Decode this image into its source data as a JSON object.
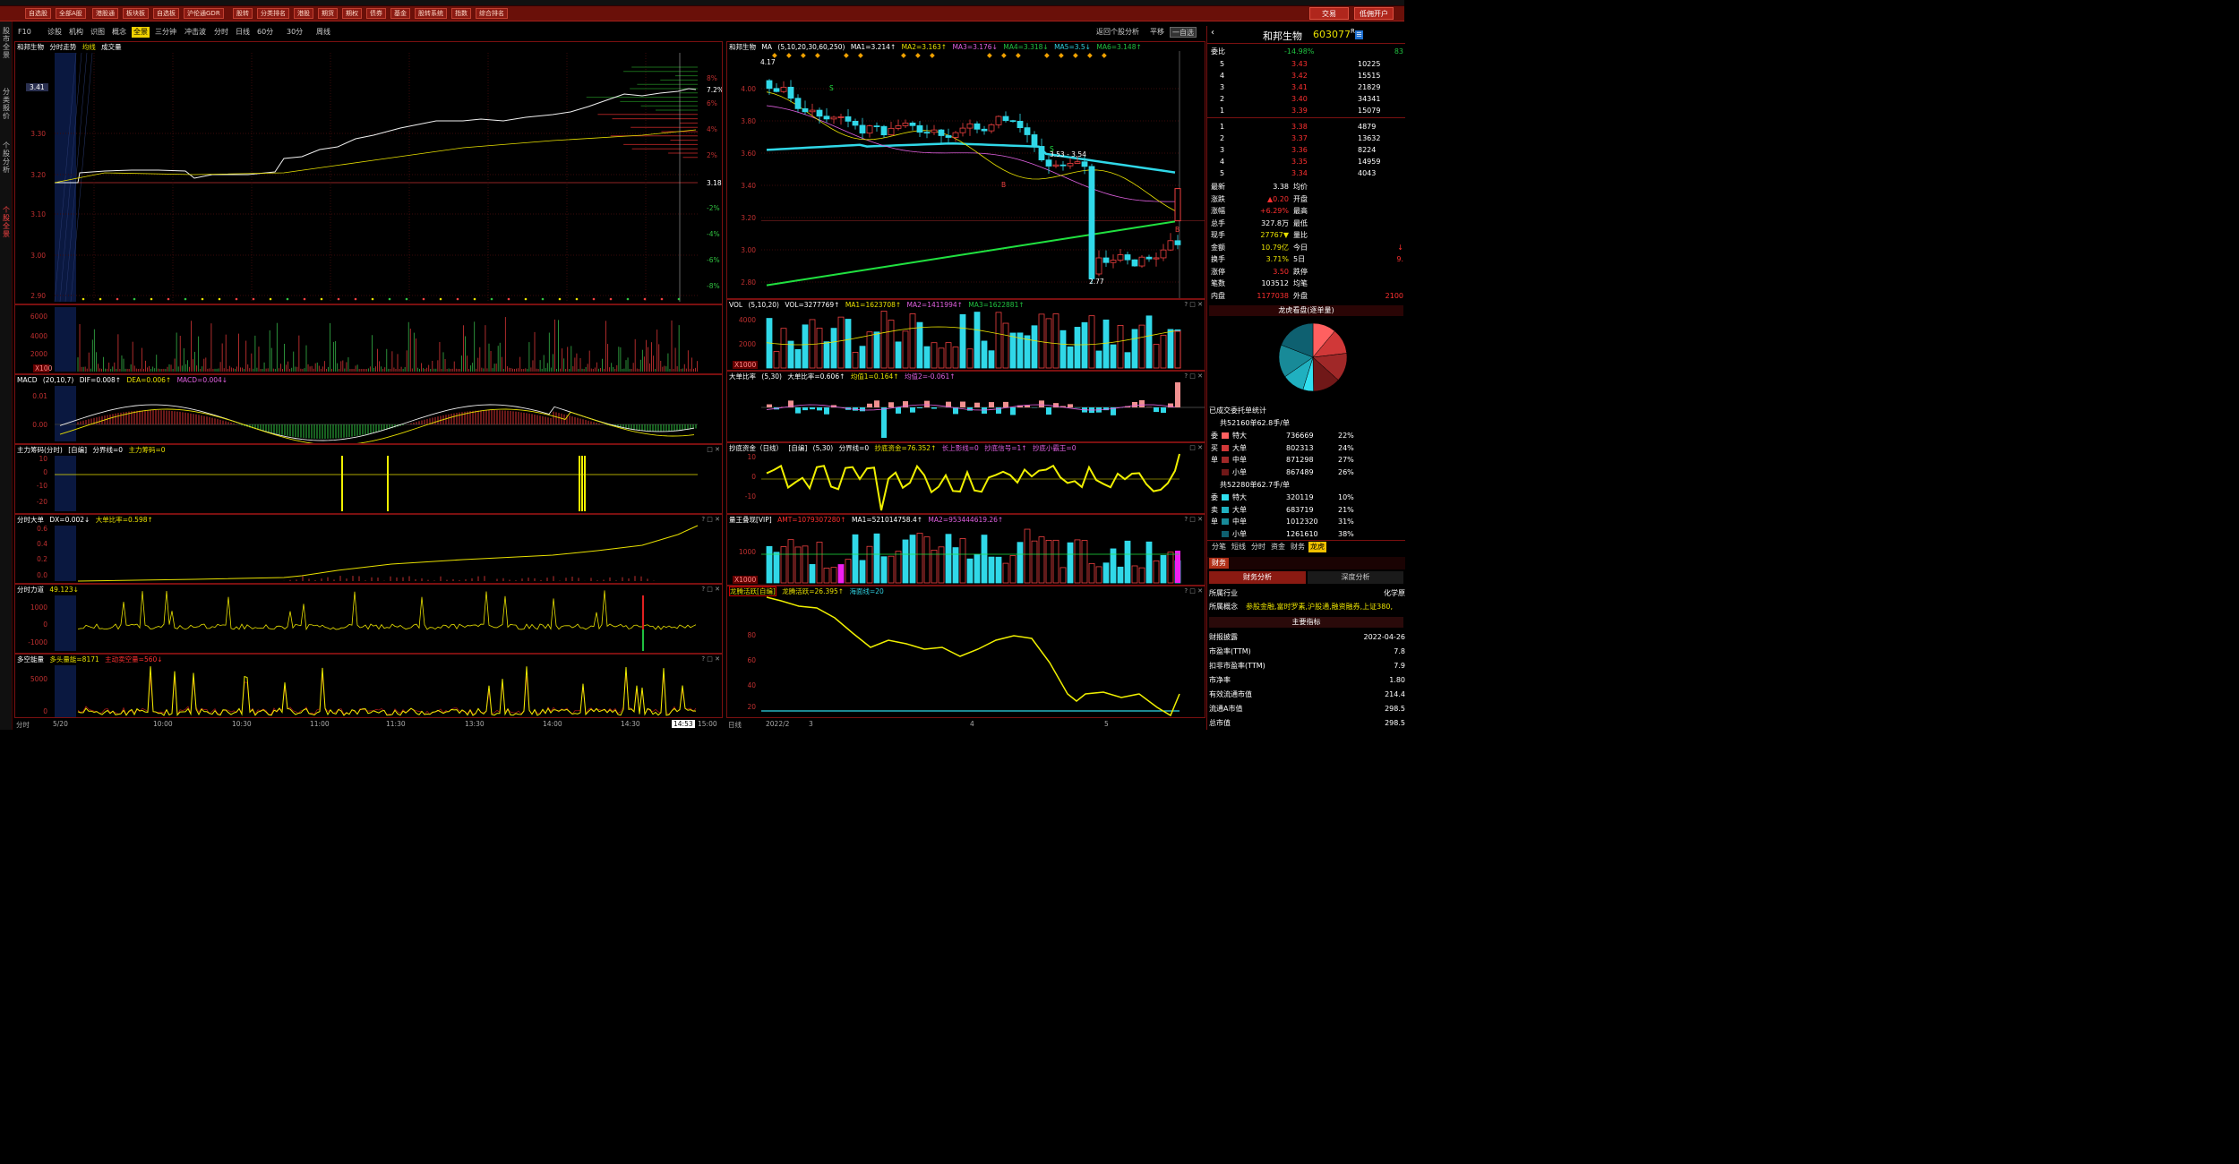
{
  "topbar": {
    "title": ""
  },
  "toolbar": {
    "items": [
      "自选股",
      "全部A股",
      "港股通",
      "板块板",
      "自选板",
      "沪伦通GDR",
      "股转",
      "分类排名",
      "港股",
      "期货",
      "期权",
      "债券",
      "基金",
      "股转系统",
      "指数",
      "综合排名"
    ],
    "trade": "交易",
    "open_account": "低佣开户"
  },
  "left_sidebar": {
    "tabs": [
      "股市全景",
      "分类报价",
      "个股分析",
      "个股全景"
    ]
  },
  "intraday_bar": {
    "items": [
      "F10",
      "诊股",
      "机构",
      "识图",
      "概念",
      "全景",
      "三分钟",
      "冲击波",
      "分时",
      "日线",
      "60分",
      "30分",
      "周线"
    ],
    "active": "全景"
  },
  "kline_bar": {
    "back": "返回个股分析",
    "flat": "平移",
    "select": "一自选"
  },
  "intraday": {
    "title": "和邦生物",
    "subtitle": "分时走势",
    "avg": "均线",
    "vol": "成交量",
    "price_labels": [
      "3.30",
      "3.20",
      "3.10",
      "3.00",
      "2.90"
    ],
    "pct_labels": [
      "8%",
      "7.2%",
      "6%",
      "4%",
      "2%",
      "3.18",
      "-2%",
      "-4%",
      "-6%",
      "-8%"
    ],
    "cur_price": "3.41",
    "time_labels": [
      "分时",
      "5/20",
      "10:00",
      "10:30",
      "11:00",
      "11:30",
      "13:30",
      "14:00",
      "14:30",
      "14:53",
      "15:00"
    ],
    "vol_labels": [
      "6000",
      "4000",
      "2000",
      "X100"
    ],
    "macd": {
      "name": "MACD",
      "params": "(20,10,7)",
      "dif": "DIF=0.008↑",
      "dea": "DEA=0.006↑",
      "macd": "MACD=0.004↓",
      "labels": [
        "0.01",
        "0.00"
      ]
    },
    "zlcm": {
      "name": "主力筹码(分时)",
      "mode": "[自编]",
      "line1": "分界线=0",
      "line2": "主力筹码=0",
      "labels": [
        "10",
        "0",
        "-10",
        "-20"
      ]
    },
    "fsdd": {
      "name": "分时大单",
      "dx": "DX=0.002↓",
      "ratio": "大单比率=0.598↑",
      "labels": [
        "0.6",
        "0.4",
        "0.2",
        "0.0"
      ]
    },
    "fsld": {
      "name": "分时力道",
      "val": "49.123↓",
      "labels": [
        "1000",
        "0",
        "-1000"
      ]
    },
    "dkn": {
      "name": "多空能量",
      "long": "多头量能=8171",
      "short": "主动卖空量=560↓",
      "labels": [
        "5000",
        "0"
      ]
    }
  },
  "kline": {
    "title": "和邦生物",
    "ma": "MA",
    "params": "(5,10,20,30,60,250)",
    "ma1": "MA1=3.214↑",
    "ma2": "MA2=3.163↑",
    "ma3": "MA3=3.176↓",
    "ma4": "MA4=3.318↓",
    "ma5": "MA5=3.5↓",
    "ma6": "MA6=3.148↑",
    "price_labels": [
      "4.00",
      "3.80",
      "3.60",
      "3.40",
      "3.20",
      "3.00",
      "2.80"
    ],
    "hi": "4.17",
    "lo": "2.77",
    "range": "3.53 - 3.54",
    "vol": {
      "name": "VOL",
      "params": "(5,10,20)",
      "v": "VOL=3277769↑",
      "ma1": "MA1=1623708↑",
      "ma2": "MA2=1411994↑",
      "ma3": "MA3=1622881↑",
      "labels": [
        "4000",
        "2000",
        "X1000"
      ]
    },
    "ddbl": {
      "name": "大单比率",
      "params": "(5,30)",
      "v": "大单比率=0.606↑",
      "j1": "均值1=0.164↑",
      "j2": "均值2=-0.061↑"
    },
    "cdzj": {
      "name": "抄底资金（日线）",
      "mode": "[自编]",
      "params": "(5,30)",
      "line": "分界线=0",
      "v": "抄底资金=76.352↑",
      "s1": "长上影线=0",
      "s2": "抄底信号=1↑",
      "s3": "抄底小霸王=0",
      "labels": [
        "10",
        "0",
        "-10"
      ]
    },
    "lwjx": {
      "name": "量王叠现[VIP]",
      "amt": "AMT=1079307280↑",
      "ma1": "MA1=521014758.4↑",
      "ma2": "MA2=953444619.26↑",
      "labels": [
        "1000",
        "X1000"
      ]
    },
    "ltzy": {
      "name": "龙腾活跃[自编]",
      "v": "龙腾活跃=26.395↑",
      "line": "海面线=20",
      "labels": [
        "80",
        "60",
        "40",
        "20"
      ]
    },
    "date_labels": [
      "日线",
      "2022/2",
      "3",
      "4",
      "5"
    ]
  },
  "right": {
    "name": "和邦生物",
    "code": "603077",
    "tag": "R",
    "weibi_label": "委比",
    "weibi": "-14.98%",
    "weicha": "83",
    "sell": [
      [
        "5",
        "3.43",
        "10225"
      ],
      [
        "4",
        "3.42",
        "15515"
      ],
      [
        "3",
        "3.41",
        "21829"
      ],
      [
        "2",
        "3.40",
        "34341"
      ],
      [
        "1",
        "3.39",
        "15079"
      ]
    ],
    "buy": [
      [
        "1",
        "3.38",
        "4879"
      ],
      [
        "2",
        "3.37",
        "13632"
      ],
      [
        "3",
        "3.36",
        "8224"
      ],
      [
        "4",
        "3.35",
        "14959"
      ],
      [
        "5",
        "3.34",
        "4043"
      ]
    ],
    "stats": [
      [
        "最新",
        "3.38",
        "均价",
        ""
      ],
      [
        "涨跌",
        "▲0.20",
        "开盘",
        ""
      ],
      [
        "涨幅",
        "+6.29%",
        "最高",
        ""
      ],
      [
        "总手",
        "327.8万",
        "最低",
        ""
      ],
      [
        "现手",
        "27767▼",
        "量比",
        ""
      ],
      [
        "金额",
        "10.79亿",
        "今日",
        "↓"
      ],
      [
        "换手",
        "3.71%",
        "5日",
        "9."
      ],
      [
        "涨停",
        "3.50",
        "跌停",
        ""
      ],
      [
        "笔数",
        "103512",
        "均笔",
        ""
      ],
      [
        "内盘",
        "1177038",
        "外盘",
        "2100"
      ]
    ],
    "lhk_title": "龙虎看盘(逐单量)",
    "wt_title": "已成交委托单统计",
    "buy_total": "共52160单62.8手/单",
    "buy_rows": [
      [
        "委",
        "特大",
        "736669",
        "22%"
      ],
      [
        "买",
        "大单",
        "802313",
        "24%"
      ],
      [
        "单",
        "中单",
        "871298",
        "27%"
      ],
      [
        "",
        "小单",
        "867489",
        "26%"
      ]
    ],
    "sell_total": "共52280单62.7手/单",
    "sell_rows": [
      [
        "委",
        "特大",
        "320119",
        "10%"
      ],
      [
        "卖",
        "大单",
        "683719",
        "21%"
      ],
      [
        "单",
        "中单",
        "1012320",
        "31%"
      ],
      [
        "",
        "小单",
        "1261610",
        "38%"
      ]
    ],
    "tabs": [
      "分笔",
      "短线",
      "分时",
      "资金",
      "财务",
      "龙虎"
    ],
    "fin_tab": "财务",
    "sub_tabs": [
      "财务分析",
      "深度分析"
    ],
    "industry_label": "所属行业",
    "industry": "化学原",
    "concept_label": "所属概念",
    "concept": "参股金融,富时罗素,沪股通,融资融券,上证380,",
    "main_index": "主要指标",
    "fin": [
      [
        "财报披露",
        "2022-04-26"
      ],
      [
        "市盈率(TTM)",
        "7.8"
      ],
      [
        "扣非市盈率(TTM)",
        "7.9"
      ],
      [
        "市净率",
        "1.80"
      ],
      [
        "有效流通市值",
        "214.4"
      ],
      [
        "流通A市值",
        "298.5"
      ],
      [
        "总市值",
        "298.5"
      ]
    ]
  },
  "chart_data": [
    {
      "type": "line",
      "title": "分时走势",
      "x": [
        "09:30",
        "10:00",
        "10:30",
        "11:00",
        "11:30",
        "13:30",
        "14:00",
        "14:30",
        "14:53"
      ],
      "series": [
        {
          "name": "price",
          "values": [
            3.18,
            3.21,
            3.2,
            3.24,
            3.33,
            3.34,
            3.36,
            3.4,
            3.41
          ]
        },
        {
          "name": "均线",
          "values": [
            3.18,
            3.2,
            3.2,
            3.22,
            3.26,
            3.28,
            3.3,
            3.33,
            3.34
          ]
        }
      ],
      "ylim": [
        2.88,
        3.42
      ]
    },
    {
      "type": "line",
      "title": "日线",
      "x": [
        "2022/2",
        "3",
        "4",
        "5"
      ],
      "series": [
        {
          "name": "MA1",
          "values": [
            3.9,
            3.6,
            3.5,
            3.214
          ]
        },
        {
          "name": "MA6",
          "values": [
            2.8,
            2.95,
            3.05,
            3.148
          ]
        }
      ],
      "ylim": [
        2.7,
        4.2
      ]
    }
  ]
}
